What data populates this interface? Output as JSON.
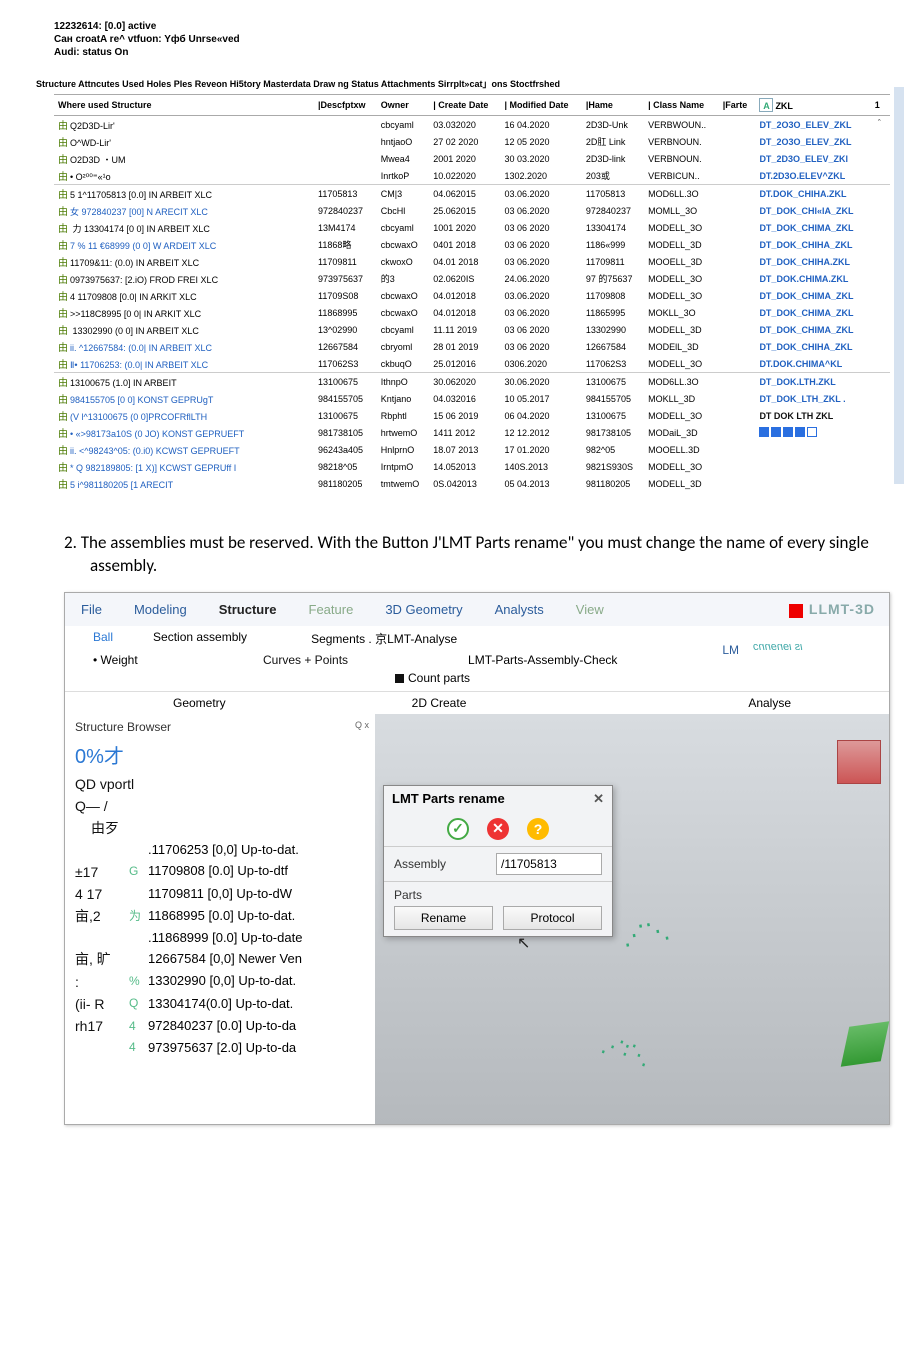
{
  "topinfo": {
    "line1": "12232614: [0.0] active",
    "line2": "Cан croatA re^ vtfuon: Yфб Unrse«ved",
    "line3": "Audi: status On"
  },
  "tabstrip": "Structure Attncutes Used Holes Ples Reveon Hi5tory Masterdata Draw ng Status Attachments Sirrplt»cat」ons Stoctfrshed",
  "headers": {
    "where": "Where used Structure",
    "desc": "|Descfptxw",
    "owner": "Owner",
    "cdate": "| Create Date",
    "mdate": "| Modified Date",
    "hname": "|Hame",
    "classn": "| Class Name",
    "farte": "|Farte",
    "zkl": "ZKL",
    "one": "1"
  },
  "upper_rows": [
    {
      "tree": "Q2D3D-Lir'",
      "owner": "cbcyaml",
      "c": "03.032020",
      "m": "16 04.2020",
      "h": "2D3D-Unk",
      "cn": "VERBWOUN..",
      "zkl": "DT_2O3O_ELEV_ZKL",
      "star": "＾"
    },
    {
      "tree": "O^WD-Lir'",
      "owner": "hntjaoO",
      "c": "27 02 2020",
      "m": "12 05 2020",
      "h": "2D肛 Link",
      "cn": "VERBNOUN.",
      "zkl": "DT_2O3O_ELEV_ZKL"
    },
    {
      "tree": "O2D3D ・UM",
      "owner": "Mwea4",
      "c": "2001 2020",
      "m": "30 03.2020",
      "h": "2D3D-link",
      "cn": "VERBNOUN.",
      "zkl": "DT_2D3O_ELEV_ZKl"
    },
    {
      "tree": "• O²⁰⁰⁼«¹ᴏ",
      "owner": "InrtkoP",
      "c": "10.022020",
      "m": "1302.2020",
      "h": "203或",
      "cn": "VERBICUN..",
      "zkl": "DT.2D3O.ELEV^ZKL"
    }
  ],
  "main_rows": [
    {
      "tree": "5 1^11705813 [0.0] IN ARBEIT XLC",
      "d": "11705813",
      "owner": "CM|3",
      "c": "04.062015",
      "m": "03.06.2020",
      "h": "11705813",
      "cn": "MOD6LL.3O",
      "zkl": "DT.DOK_CHIHA.ZKL"
    },
    {
      "tree": "女 972840237 [00] N ARECIT XLC",
      "d": "972840237",
      "owner": "CbcHl",
      "c": "25.062015",
      "m": "03 06.2020",
      "h": "972840237",
      "cn": "MOMLL_3O",
      "zkl": "DT_DOK_CHl«lA_ZKL",
      "link": true
    },
    {
      "tree": " 力   13304174 [0 0] IN ARBEIT XLC",
      "d": "13M4174",
      "owner": "cbcyaml",
      "c": "1001 2020",
      "m": "03 06 2020",
      "h": "13304174",
      "cn": "MODELL_3O",
      "zkl": "DT_DOK_CHIMA_ZKL"
    },
    {
      "tree": "7 % 11 €68999 (0 0] W ARDEIT XLC",
      "d": "11868略",
      "owner": "cbcwaxO",
      "c": "0401 2018",
      "m": "03 06 2020",
      "h": "1186«999",
      "cn": "MODELL_3D",
      "zkl": "DT_DOK_CHIHA_ZKL",
      "link": true
    },
    {
      "tree": "11709&11: (0.0) IN ARBEIT XLC",
      "d": "11709811",
      "owner": "ckwoxO",
      "c": "04.01 2018",
      "m": "03 06.2020",
      "h": "11709811",
      "cn": "MOOELL_3D",
      "zkl": "DT_DOK_CHIHA.ZKL"
    },
    {
      "tree": "0973975637: [2.iO) FROD FREI XLC",
      "d": "973975637",
      "owner": "的3",
      "c": "02.0620IS",
      "m": "24.06.2020",
      "h": "97 的75637",
      "cn": "MODELL_3O",
      "zkl": "DT_DOK.CHIMA.ZKL"
    },
    {
      "tree": "4 11709808 [0.0| IN ARKIT XLC",
      "d": "11709S08",
      "owner": "cbcwaxO",
      "c": "04.012018",
      "m": "03.06.2020",
      "h": "11709808",
      "cn": "MODELL_3O",
      "zkl": "DT_DOK_CHIMA_ZKL"
    },
    {
      "tree": ">>118C8995 [0 0| IN ARKIT XLC",
      "d": "11868995",
      "owner": "cbcwaxO",
      "c": "04.012018",
      "m": "03 06.2020",
      "h": "11865995",
      "cn": "MOKLL_3O",
      "zkl": "DT_DOK_CHIMA_ZKL"
    },
    {
      "tree": " 13302990 (0 0] IN ARBEIT XLC",
      "d": "13^02990",
      "owner": "cbcyaml",
      "c": "11.11 2019",
      "m": "03 06 2020",
      "h": "13302990",
      "cn": "MODELL_3D",
      "zkl": "DT_DOK_CHIMA_ZKL"
    },
    {
      "tree": "ii. ^12667584: (0.0| IN ARBEIT XLC",
      "d": "12667584",
      "owner": "cbryoml",
      "c": "28 01 2019",
      "m": "03 06 2020",
      "h": "12667584",
      "cn": "MODElL_3D",
      "zkl": "DT_DOK_CHIHA_ZKL",
      "link": true
    },
    {
      "tree": "Ⅱ•   11706253: (0.0| IN ARBEIT XLC",
      "d": "117062S3",
      "owner": "ckbuqO",
      "c": "25.012016",
      "m": "0306.2020",
      "h": "117062S3",
      "cn": "MODELL_3O",
      "zkl": "DT.DOK.CHIMA^KL",
      "link": true
    }
  ],
  "lower_rows": [
    {
      "tree": "13100675 (1.0] IN ARBEIT",
      "d": "13100675",
      "owner": "IthnpO",
      "c": "30.062020",
      "m": "30.06.2020",
      "h": "13100675",
      "cn": "MOD6LL.3O",
      "zkl": "DT_DOK.LTH.ZKL"
    },
    {
      "tree": "984155705 [0 0] KONST GEPRUgT",
      "d": "984155705",
      "owner": "Kntjano",
      "c": "04.032016",
      "m": "10 05.2017",
      "h": "984155705",
      "cn": "MOKLL_3D",
      "zkl": "DT_DOK_LTH_ZKL .",
      "link": true
    },
    {
      "tree": "(V l^13100675 (0 0]PRCOFRflLTH",
      "d": "13100675",
      "owner": "Rbphtl",
      "c": "15 06 2019",
      "m": "06 04.2020",
      "h": "13100675",
      "cn": "MODELL_3O",
      "zkl": "DT DOK LTH ZKL",
      "blk": true,
      "link": true
    },
    {
      "tree": "• «>98173a10S (0 JO) KONST GEPRUEFT",
      "d": "981738105",
      "owner": "hrtwemO",
      "c": "1411 2012",
      "m": "12 12.2012",
      "h": "981738105",
      "cn": "MODaiL_3D",
      "audit": true,
      "link": true
    },
    {
      "tree": "ii. <^98243^05: (0.i0) KCWST GEPRUEFT",
      "d": "96243a405",
      "owner": "HnlprnO",
      "c": "18.07 2013",
      "m": "17 01.2020",
      "h": "982^05",
      "cn": "MOOELL.3D",
      "link": true
    },
    {
      "tree": "* Q 982189805: [1 X)] KCWST GEPRUff I",
      "d": "98218^05",
      "owner": "IrntpmO",
      "c": "14.052013",
      "m": "140S.2013",
      "h": "9821S930S",
      "cn": "MODELL_3O",
      "link": true
    },
    {
      "tree": "5 i^981180205 [1            ARECIT",
      "d": "981180205",
      "owner": "tmtwemO",
      "c": "0S.042013",
      "m": "05 04.2013",
      "h": "981180205",
      "cn": "MODELL_3D",
      "link": true
    }
  ],
  "instruction": "2.  The assemblies must be reserved. With the Button J'LMT Parts rename\" you must change the name of every single assembly.",
  "menu": {
    "file": "File",
    "modeling": "Modeling",
    "structure": "Structure",
    "feature": "Feature",
    "geo3d": "3D Geometry",
    "analysts": "Analysts",
    "view": "View",
    "brand": "LLMT-3D"
  },
  "sub": {
    "ball": "Ball",
    "section": "Section assembly",
    "segments": "Segments . 京LMT-Analyse",
    "weight": "• Weight",
    "curves": "Curves + Points",
    "assycheck": "LMT-Parts-Assembly-Check",
    "count": "Count parts",
    "geometry": "Geometry",
    "create2d": "2D Create",
    "analyse": "Analyse",
    "lm": "LM",
    "pink": "ιs ιɘnɘnnɔ"
  },
  "browser": {
    "title": "Structure Browser",
    "qx": "Q x",
    "hdr1": "0%才",
    "hdr2": "QD vportl",
    "hdr3": "Q— /",
    "hdr4": "由歹",
    "items": [
      {
        "p": "",
        "ic": "",
        "n": ".11706253 [0,0] Up-to-dat."
      },
      {
        "p": "±17",
        "ic": "G",
        "n": "11709808 [0.0] Up-to-dtf",
        "lnk": true
      },
      {
        "p": "4  17",
        "ic": "",
        "n": "11709811   [0,0]   Up-to-dW",
        "lnk": true
      },
      {
        "p": "亩,2",
        "ic": "为",
        "n": "11868995  [0.0]  Up-to-dat."
      },
      {
        "p": "",
        "ic": "",
        "n": ".11868999 [0.0] Up-to-date"
      },
      {
        "p": "亩, 旷",
        "ic": "",
        "n": "12667584  [0,0]  Newer Ven"
      },
      {
        "p": ":",
        "ic": "%",
        "n": "13302990   [0,0]   Up-to-dat."
      },
      {
        "p": "(ii- R",
        "ic": "Q",
        "n": "13304174(0.0]     Up-to-dat.",
        "pblue": true
      },
      {
        "p": "rh17",
        "ic": "4",
        "n": "972840237   [0.0]   Up-to-da"
      },
      {
        "p": "",
        "ic": "4",
        "n": "973975637 [2.0] Up-to-da"
      }
    ]
  },
  "dialog": {
    "title": "LMT Parts rename",
    "assembly_lbl": "Assembly",
    "assembly_val": "/11705813",
    "parts_lbl": "Parts",
    "rename": "Rename",
    "protocol": "Protocol"
  }
}
